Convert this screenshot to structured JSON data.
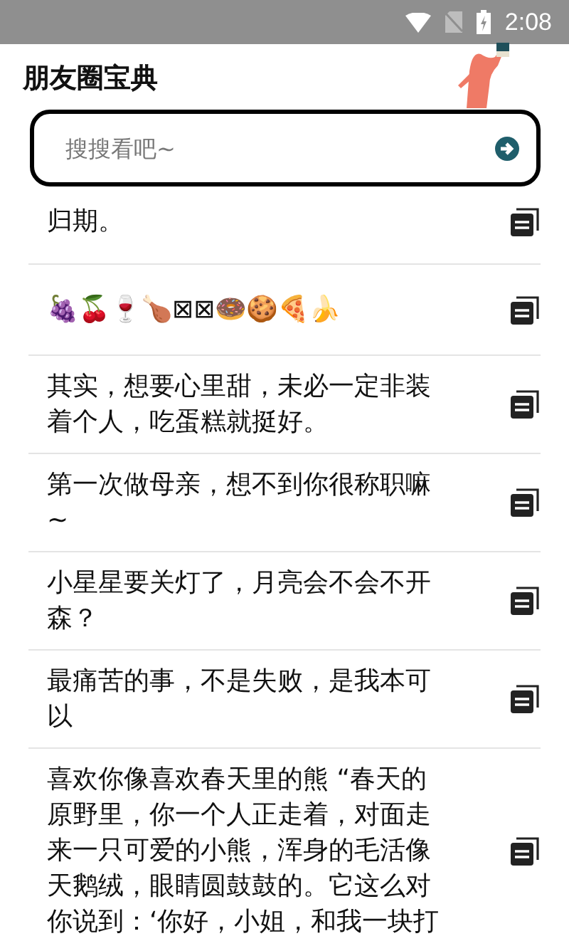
{
  "status_bar": {
    "time": "2:08"
  },
  "header": {
    "title": "朋友圈宝典"
  },
  "search": {
    "placeholder": "搜搜看吧~"
  },
  "items": [
    {
      "text": "归期。"
    },
    {
      "text": "🍇🍒🍷🍗⊠⊠🍩🍪🍕🍌"
    },
    {
      "text": "其实，想要心里甜，未必一定非装着个人，吃蛋糕就挺好。"
    },
    {
      "text": "第一次做母亲，想不到你很称职嘛~"
    },
    {
      "text": "小星星要关灯了，月亮会不会不开森？"
    },
    {
      "text": "最痛苦的事，不是失败，是我本可以"
    },
    {
      "text": "喜欢你像喜欢春天里的熊 “春天的原野里，你一个人正走着，对面走来一只可爱的小熊，浑身的毛活像天鹅绒，眼睛圆鼓鼓的。它这么对你说到：‘你好，小姐，和我一块打"
    }
  ]
}
